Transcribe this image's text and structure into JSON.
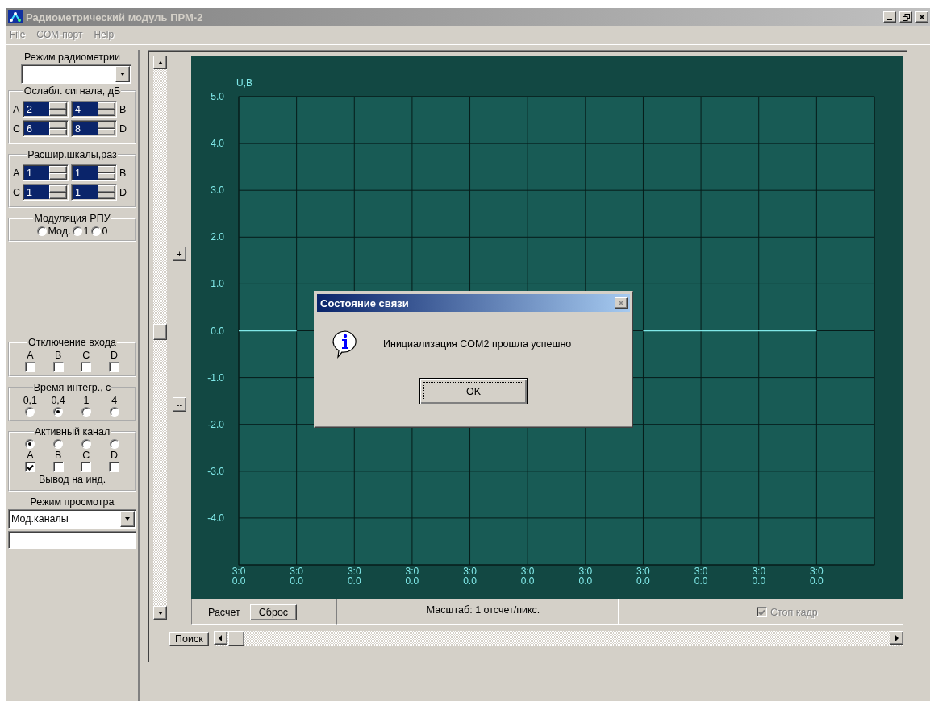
{
  "window": {
    "title": "Радиометрический модуль ПРМ-2"
  },
  "menu": [
    {
      "label": "File"
    },
    {
      "label": "COM-порт"
    },
    {
      "label": "Help"
    }
  ],
  "sidebar": {
    "radiometry_mode": {
      "label": "Режим радиометрии"
    },
    "attenuation": {
      "title": "Ослабл. сигнала, дБ",
      "spinners": [
        {
          "channel": "A",
          "value": "2"
        },
        {
          "channel": "B",
          "value": "4"
        },
        {
          "channel": "C",
          "value": "6"
        },
        {
          "channel": "D",
          "value": "8"
        }
      ]
    },
    "scale_expansion": {
      "title": "Расшир.шкалы,раз",
      "spinners": [
        {
          "channel": "A",
          "value": "1"
        },
        {
          "channel": "B",
          "value": "1"
        },
        {
          "channel": "C",
          "value": "1"
        },
        {
          "channel": "D",
          "value": "1"
        }
      ]
    },
    "modulation": {
      "title": "Модуляция РПУ",
      "options": [
        {
          "label": "Мод.",
          "selected": false
        },
        {
          "label": "1",
          "selected": false
        },
        {
          "label": "0",
          "selected": false
        }
      ]
    },
    "input_off": {
      "title": "Отключение входа",
      "items": [
        {
          "label": "A",
          "checked": false
        },
        {
          "label": "B",
          "checked": false
        },
        {
          "label": "C",
          "checked": false
        },
        {
          "label": "D",
          "checked": false
        }
      ]
    },
    "integration_time": {
      "title": "Время интегр., с",
      "options": [
        {
          "label": "0,1",
          "selected": false
        },
        {
          "label": "0,4",
          "selected": true
        },
        {
          "label": "1",
          "selected": false
        },
        {
          "label": "4",
          "selected": false
        }
      ]
    },
    "active_channel": {
      "title": "Активный канал",
      "channels": [
        {
          "label": "A",
          "selected": true,
          "output": true
        },
        {
          "label": "B",
          "selected": false,
          "output": false
        },
        {
          "label": "C",
          "selected": false,
          "output": false
        },
        {
          "label": "D",
          "selected": false,
          "output": false
        }
      ],
      "footer": "Вывод на инд."
    },
    "view_mode": {
      "label": "Режим просмотра",
      "value": "Мод.каналы"
    }
  },
  "zoom_buttons": [
    {
      "label": "+"
    },
    {
      "label": "--"
    }
  ],
  "chart": {
    "chart_data": {
      "type": "line",
      "ylabel": "U,B",
      "ylim": [
        -5,
        5
      ],
      "yticks": [
        {
          "value": 5,
          "label": "5.0"
        },
        {
          "value": 4,
          "label": "4.0"
        },
        {
          "value": 3,
          "label": "3.0"
        },
        {
          "value": 2,
          "label": "2.0"
        },
        {
          "value": 1,
          "label": "1.0"
        },
        {
          "value": 0,
          "label": "0.0"
        },
        {
          "value": -1,
          "label": "-1.0"
        },
        {
          "value": -2,
          "label": "-2.0"
        },
        {
          "value": -3,
          "label": "-3.0"
        },
        {
          "value": -4,
          "label": "-4.0"
        }
      ],
      "categories": [
        "3:0\n0.0",
        "3:0\n0.0",
        "3:0\n0.0",
        "3:0\n0.0",
        "3:0\n0.0",
        "3:0\n0.0",
        "3:0\n0.0",
        "3:0\n0.0",
        "3:0\n0.0",
        "3:0\n0.0",
        "3:0\n0.0"
      ],
      "grid": true,
      "series": [
        {
          "color": "#80e8e8",
          "values": [
            0,
            0,
            null,
            null,
            null,
            null,
            null,
            0,
            0,
            0,
            0
          ]
        }
      ]
    }
  },
  "status": {
    "calc_label": "Расчет",
    "reset_button": "Сброс",
    "scale": "Масштаб: 1 отсчет/пикс.",
    "freeze": {
      "label": "Стоп кадр",
      "checked": true,
      "disabled": true
    }
  },
  "search_button": "Поиск",
  "dialog": {
    "title": "Состояние связи",
    "message": "Инициализация COM2 прошла успешно",
    "ok": "OK"
  }
}
